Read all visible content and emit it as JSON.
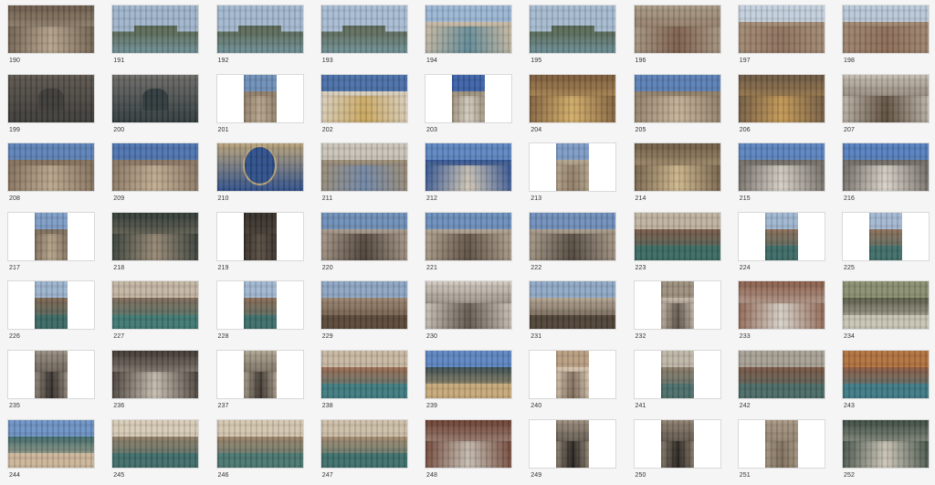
{
  "thumbnails": [
    {
      "label": "190",
      "orientation": "landscape",
      "scene": "aerial-domes",
      "colors": [
        "#8a8f99",
        "#b7a58e",
        "#6a5a4a"
      ]
    },
    {
      "label": "191",
      "orientation": "landscape",
      "scene": "lagoon-island",
      "colors": [
        "#9fb4cc",
        "#6f8f96",
        "#5c6b58"
      ]
    },
    {
      "label": "192",
      "orientation": "landscape",
      "scene": "lagoon-island",
      "colors": [
        "#a3b8cf",
        "#6e9098",
        "#5d6b5a"
      ]
    },
    {
      "label": "193",
      "orientation": "landscape",
      "scene": "lagoon-island",
      "colors": [
        "#a8bcd2",
        "#6f9097",
        "#606d5d"
      ]
    },
    {
      "label": "194",
      "orientation": "landscape",
      "scene": "church-waterfront",
      "colors": [
        "#9bb6d4",
        "#5d8896",
        "#c9b9a2"
      ]
    },
    {
      "label": "195",
      "orientation": "landscape",
      "scene": "lagoon-island",
      "colors": [
        "#a6bbd0",
        "#6a8d96",
        "#5a6a58"
      ]
    },
    {
      "label": "196",
      "orientation": "landscape",
      "scene": "rooftops",
      "colors": [
        "#8a7f70",
        "#7b5c4a",
        "#a99a85"
      ]
    },
    {
      "label": "197",
      "orientation": "landscape",
      "scene": "rooftops-sky",
      "colors": [
        "#c2cfdc",
        "#8c6e5a",
        "#a28b74"
      ]
    },
    {
      "label": "198",
      "orientation": "landscape",
      "scene": "rooftops-sky",
      "colors": [
        "#b9c8d8",
        "#8a6a55",
        "#9f8670"
      ]
    },
    {
      "label": "199",
      "orientation": "landscape",
      "scene": "bell",
      "colors": [
        "#d8d2c8",
        "#3b3a37",
        "#5c554d"
      ]
    },
    {
      "label": "200",
      "orientation": "landscape",
      "scene": "bell",
      "colors": [
        "#e3ded6",
        "#2f3a3c",
        "#6b6a66"
      ]
    },
    {
      "label": "201",
      "orientation": "portrait",
      "scene": "facade",
      "colors": [
        "#6e8fb8",
        "#b9a78e",
        "#8c7a66"
      ]
    },
    {
      "label": "202",
      "orientation": "landscape",
      "scene": "facade-gold",
      "colors": [
        "#4a6fa8",
        "#c9a55a",
        "#d8cfc0"
      ]
    },
    {
      "label": "203",
      "orientation": "portrait",
      "scene": "statue",
      "colors": [
        "#3c62a8",
        "#d6cfc2",
        "#9a8c78"
      ]
    },
    {
      "label": "204",
      "orientation": "landscape",
      "scene": "mosaic",
      "colors": [
        "#b98a4a",
        "#d5b06a",
        "#7a5a3a"
      ]
    },
    {
      "label": "205",
      "orientation": "landscape",
      "scene": "facade",
      "colors": [
        "#5b7fb6",
        "#c7b49a",
        "#8d7b64"
      ]
    },
    {
      "label": "206",
      "orientation": "landscape",
      "scene": "arch-mosaic",
      "colors": [
        "#b59a78",
        "#c79a55",
        "#6a5642"
      ]
    },
    {
      "label": "207",
      "orientation": "landscape",
      "scene": "horses",
      "colors": [
        "#9a968f",
        "#5a4a3a",
        "#c4bcb0"
      ]
    },
    {
      "label": "208",
      "orientation": "landscape",
      "scene": "basilica",
      "colors": [
        "#5d82b8",
        "#bca88e",
        "#7f6c58"
      ]
    },
    {
      "label": "209",
      "orientation": "landscape",
      "scene": "basilica",
      "colors": [
        "#4d74b0",
        "#c2ae92",
        "#857260"
      ]
    },
    {
      "label": "210",
      "orientation": "landscape",
      "scene": "clock",
      "colors": [
        "#d7d1c6",
        "#2e4f8a",
        "#b8a27a"
      ]
    },
    {
      "label": "211",
      "orientation": "landscape",
      "scene": "tower",
      "colors": [
        "#c9c3b8",
        "#6e86a8",
        "#9c8c74"
      ]
    },
    {
      "label": "212",
      "orientation": "landscape",
      "scene": "lion-tower",
      "colors": [
        "#5d86c2",
        "#d2c8b6",
        "#2f5190"
      ]
    },
    {
      "label": "213",
      "orientation": "portrait",
      "scene": "tower",
      "colors": [
        "#7d9bc6",
        "#8e7a64",
        "#b1a28c"
      ]
    },
    {
      "label": "214",
      "orientation": "landscape",
      "scene": "arch-mosaic",
      "colors": [
        "#a78a68",
        "#d0b98e",
        "#6d5a44"
      ]
    },
    {
      "label": "215",
      "orientation": "landscape",
      "scene": "piazza",
      "colors": [
        "#5b84c0",
        "#d8d2c8",
        "#6c6660"
      ]
    },
    {
      "label": "216",
      "orientation": "landscape",
      "scene": "piazza",
      "colors": [
        "#557fbe",
        "#dcd6cc",
        "#6a645e"
      ]
    },
    {
      "label": "217",
      "orientation": "portrait",
      "scene": "street",
      "colors": [
        "#7d9cc6",
        "#b8a68c",
        "#7a6a58"
      ]
    },
    {
      "label": "218",
      "orientation": "landscape",
      "scene": "shopfront",
      "colors": [
        "#4f8a6e",
        "#9a8a76",
        "#2f3a34"
      ]
    },
    {
      "label": "219",
      "orientation": "portrait",
      "scene": "alley",
      "colors": [
        "#8aa8cc",
        "#5a4e42",
        "#332d28"
      ]
    },
    {
      "label": "220",
      "orientation": "landscape",
      "scene": "alley-up",
      "colors": [
        "#6f8fb8",
        "#4a3f36",
        "#a8998a"
      ]
    },
    {
      "label": "221",
      "orientation": "landscape",
      "scene": "alley-up",
      "colors": [
        "#6c8fbc",
        "#5a4d40",
        "#b0a290"
      ]
    },
    {
      "label": "222",
      "orientation": "landscape",
      "scene": "alley-up",
      "colors": [
        "#708fba",
        "#4e453c",
        "#a99b89"
      ]
    },
    {
      "label": "223",
      "orientation": "landscape",
      "scene": "canal",
      "colors": [
        "#bfb2a0",
        "#3a6a62",
        "#7a5a48"
      ]
    },
    {
      "label": "224",
      "orientation": "portrait",
      "scene": "canal",
      "colors": [
        "#9eb6d0",
        "#3c6a66",
        "#8a6c56"
      ]
    },
    {
      "label": "225",
      "orientation": "portrait",
      "scene": "canal",
      "colors": [
        "#a2b8d2",
        "#3f6d68",
        "#8c6e58"
      ]
    },
    {
      "label": "226",
      "orientation": "portrait",
      "scene": "canal",
      "colors": [
        "#9bb3cd",
        "#3a6864",
        "#7e6450"
      ]
    },
    {
      "label": "227",
      "orientation": "landscape",
      "scene": "canal-bridge",
      "colors": [
        "#c3b5a2",
        "#3f7872",
        "#7f6a58"
      ]
    },
    {
      "label": "228",
      "orientation": "portrait",
      "scene": "canal",
      "colors": [
        "#a0b7d0",
        "#3d6e6a",
        "#8a6a54"
      ]
    },
    {
      "label": "229",
      "orientation": "landscape",
      "scene": "canal-bridge",
      "colors": [
        "#8da6c4",
        "#5a4838",
        "#9a8470"
      ]
    },
    {
      "label": "230",
      "orientation": "landscape",
      "scene": "alley",
      "colors": [
        "#b9b2a6",
        "#5e544a",
        "#d2cac0"
      ]
    },
    {
      "label": "231",
      "orientation": "landscape",
      "scene": "canal-bridge",
      "colors": [
        "#8fa9c6",
        "#4f4336",
        "#b3a492"
      ]
    },
    {
      "label": "232",
      "orientation": "portrait",
      "scene": "street",
      "colors": [
        "#9c8e7c",
        "#5b4f44",
        "#c2b6a6"
      ]
    },
    {
      "label": "233",
      "orientation": "landscape",
      "scene": "cafe",
      "colors": [
        "#2f4a3e",
        "#d8d4cc",
        "#8a5c48"
      ]
    },
    {
      "label": "234",
      "orientation": "landscape",
      "scene": "canal-side",
      "colors": [
        "#8a8f70",
        "#c8c4b4",
        "#5a5a48"
      ]
    },
    {
      "label": "235",
      "orientation": "portrait",
      "scene": "alley",
      "colors": [
        "#6a5e52",
        "#2f2a26",
        "#9a8e80"
      ]
    },
    {
      "label": "236",
      "orientation": "landscape",
      "scene": "alley",
      "colors": [
        "#6e6254",
        "#c9c0b2",
        "#3e3630"
      ]
    },
    {
      "label": "237",
      "orientation": "portrait",
      "scene": "alley",
      "colors": [
        "#7e725f",
        "#3a332c",
        "#b1a592"
      ]
    },
    {
      "label": "238",
      "orientation": "landscape",
      "scene": "canal-houses",
      "colors": [
        "#c8b8a2",
        "#3f7b80",
        "#9a6a50"
      ]
    },
    {
      "label": "239",
      "orientation": "landscape",
      "scene": "canal-houses",
      "colors": [
        "#5d86c2",
        "#c6a878",
        "#3a4c50"
      ]
    },
    {
      "label": "240",
      "orientation": "portrait",
      "scene": "facade",
      "colors": [
        "#b89e82",
        "#7a6656",
        "#d4c4ae"
      ]
    },
    {
      "label": "241",
      "orientation": "portrait",
      "scene": "canal",
      "colors": [
        "#bfb7a8",
        "#4b6e6a",
        "#8a7a66"
      ]
    },
    {
      "label": "242",
      "orientation": "landscape",
      "scene": "canal-houses",
      "colors": [
        "#a8a094",
        "#4a6a66",
        "#7a5644"
      ]
    },
    {
      "label": "243",
      "orientation": "landscape",
      "scene": "canal-houses",
      "colors": [
        "#b2723e",
        "#3e7a86",
        "#8e5a40"
      ]
    },
    {
      "label": "244",
      "orientation": "landscape",
      "scene": "canal-houses",
      "colors": [
        "#6d92c4",
        "#cbb598",
        "#3e6a6a"
      ]
    },
    {
      "label": "245",
      "orientation": "landscape",
      "scene": "canal-houses",
      "colors": [
        "#d7cbb6",
        "#3f6d6a",
        "#8f7c66"
      ]
    },
    {
      "label": "246",
      "orientation": "landscape",
      "scene": "canal-bridge",
      "colors": [
        "#d4c6b0",
        "#4a7670",
        "#9a8268"
      ]
    },
    {
      "label": "247",
      "orientation": "landscape",
      "scene": "canal-houses",
      "colors": [
        "#cdbea8",
        "#3d6f6c",
        "#a38a6e"
      ]
    },
    {
      "label": "248",
      "orientation": "landscape",
      "scene": "alley",
      "colors": [
        "#8e4a3a",
        "#c8c0b4",
        "#6a3e30"
      ]
    },
    {
      "label": "249",
      "orientation": "portrait",
      "scene": "alley",
      "colors": [
        "#5a4e44",
        "#221e1a",
        "#9a8c7c"
      ]
    },
    {
      "label": "250",
      "orientation": "portrait",
      "scene": "alley",
      "colors": [
        "#5c5046",
        "#24201c",
        "#8e8070"
      ]
    },
    {
      "label": "251",
      "orientation": "portrait",
      "scene": "alley",
      "colors": [
        "#c8bba8",
        "#7c6c5a",
        "#a69682"
      ]
    },
    {
      "label": "252",
      "orientation": "landscape",
      "scene": "alley",
      "colors": [
        "#7a5a48",
        "#d0c8ba",
        "#3a4a40"
      ]
    }
  ]
}
